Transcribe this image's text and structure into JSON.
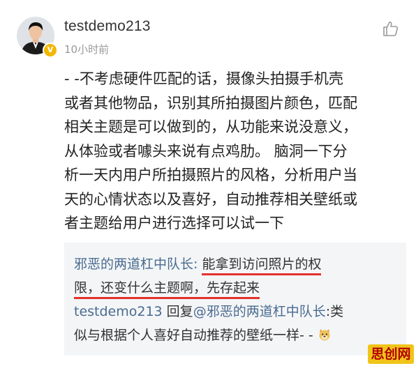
{
  "post": {
    "username": "testdemo213",
    "timestamp": "10小时前",
    "icons": {
      "avatar": "avatar",
      "verified": "verified-badge-icon",
      "like": "thumbs-up-icon"
    },
    "body_lines": [
      "- -不考虑硬件匹配的话，摄像头拍摄手机壳",
      "或者其他物品，识别其所拍摄图片颜色，匹配",
      "相关主题是可以做到的，从功能来说没意义，",
      "从体验或者噱头来说有点鸡肋。 脑洞一下分",
      "析一天内用户所拍摄照片的风格，分析用户当",
      "天的心情状态以及喜好，自动推荐相关壁纸或",
      "者主题给用户进行选择可以试一下"
    ]
  },
  "replies": {
    "first": {
      "user": "邪恶的两道杠中队长",
      "colon": ": ",
      "line1_text": "能拿到访问照片的权",
      "line2_text": "限，还变什么主题啊，先存起来"
    },
    "second": {
      "user": "testdemo213",
      "reply_word": " 回复",
      "mention": "@邪恶的两道杠中队长",
      "colon": ":",
      "line1_text": "类",
      "line2_text": "似与根据个人喜好自动推荐的壁纸一样- -"
    }
  },
  "watermark": {
    "text": "思创网"
  },
  "colors": {
    "link": "#486b8f",
    "highlight_underline": "#e3312d",
    "reply_background": "#f4f5f7",
    "badge": "#f2b705"
  }
}
